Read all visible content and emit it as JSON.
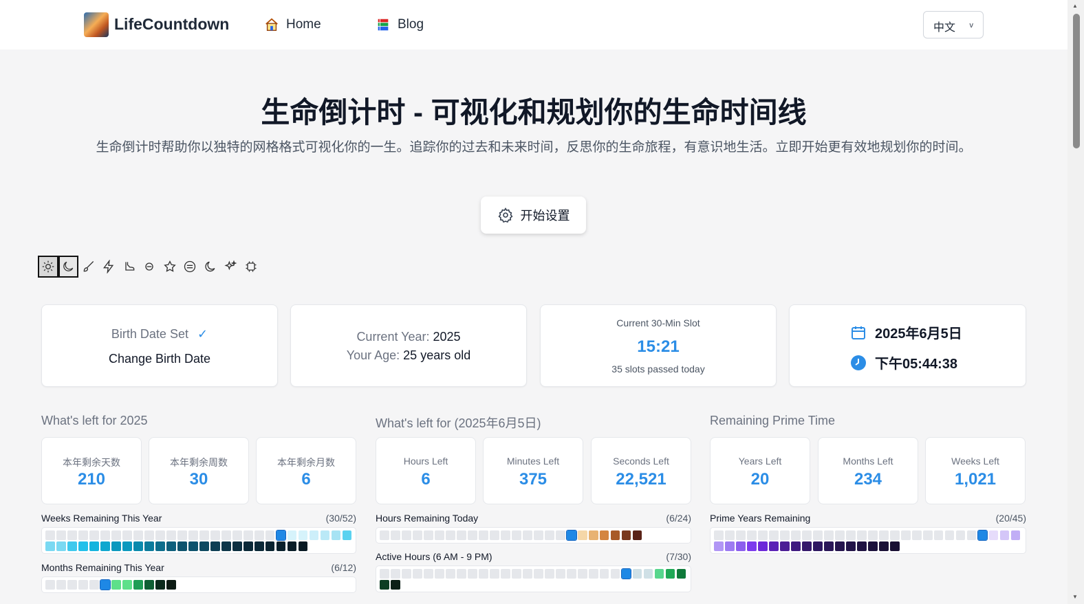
{
  "nav": {
    "brand": "LifeCountdown",
    "home": "Home",
    "blog": "Blog",
    "language": "中文",
    "language_chevron": "v"
  },
  "hero": {
    "title": "生命倒计时 - 可视化和规划你的生命时间线",
    "subtitle": "生命倒计时帮助你以独特的网格格式可视化你的一生。追踪你的过去和未来时间，反思你的生命旅程，有意识地生活。立即开始更有效地规划你的时间。",
    "start_button": "开始设置"
  },
  "themes": [
    "sun-icon",
    "moon-icon",
    "brush-icon",
    "lightning-icon",
    "boot-icon",
    "candy-icon",
    "star-icon",
    "circle-icon",
    "crescent-icon",
    "sparkles-icon",
    "chip-icon"
  ],
  "birth_card": {
    "status": "Birth Date Set",
    "check": "✓",
    "action": "Change Birth Date"
  },
  "year_card": {
    "year_label": "Current Year: ",
    "year_value": "2025",
    "age_label": "Your Age: ",
    "age_value": "25 years old"
  },
  "slot_card": {
    "label": "Current 30-Min Slot",
    "value": "15:21",
    "note": "35 slots passed today"
  },
  "datetime_card": {
    "date": "2025年6月5日",
    "time": "下午05:44:38"
  },
  "sections": {
    "year": {
      "title": "What's left for 2025",
      "stats": [
        {
          "label": "本年剩余天数",
          "value": "210"
        },
        {
          "label": "本年剩余周数",
          "value": "30"
        },
        {
          "label": "本年剩余月数",
          "value": "6"
        }
      ],
      "grids": [
        {
          "label": "Weeks Remaining This Year",
          "count": "(30/52)"
        },
        {
          "label": "Months Remaining This Year",
          "count": "(6/12)"
        }
      ]
    },
    "day": {
      "title": "What's left for (2025年6月5日)",
      "stats": [
        {
          "label": "Hours Left",
          "value": "6"
        },
        {
          "label": "Minutes Left",
          "value": "375"
        },
        {
          "label": "Seconds Left",
          "value": "22,521"
        }
      ],
      "grids": [
        {
          "label": "Hours Remaining Today",
          "count": "(6/24)"
        },
        {
          "label": "Active Hours (6 AM - 9 PM)",
          "count": "(7/30)"
        }
      ]
    },
    "prime": {
      "title": "Remaining Prime Time",
      "stats": [
        {
          "label": "Years Left",
          "value": "20"
        },
        {
          "label": "Months Left",
          "value": "234"
        },
        {
          "label": "Weeks Left",
          "value": "1,021"
        }
      ],
      "grids": [
        {
          "label": "Prime Years Remaining",
          "count": "(20/45)"
        }
      ]
    }
  },
  "grid_colors": {
    "weeks": [
      "#d6f3fb",
      "#cdeffa",
      "#bae9f7",
      "#a7e3f4",
      "#5bd2f0",
      "#7ad9f2",
      "#3ec9ed",
      "#22c0ea",
      "#14b4de",
      "#0fa7cf",
      "#0b99be",
      "#0a8aad",
      "#0b7b9c",
      "#0c6d8c",
      "#0d5f7c",
      "#0e536d",
      "#0e4960",
      "#0e3f54",
      "#0d3649",
      "#0c2f40",
      "#0b2938",
      "#0a2431",
      "#0a202c",
      "#091c27",
      "#081923"
    ],
    "months": [
      "#5ee08a",
      "#1f9d55",
      "#0f5f34",
      "#0b2a1c",
      "#0d1b14"
    ],
    "hours": [
      "#f5d7a8",
      "#e8b272",
      "#d48540",
      "#a85a27",
      "#7a3a1f",
      "#5a2318"
    ],
    "active": [
      "#cfe0e6",
      "#57d68d",
      "#1fa855",
      "#0f7a3a",
      "#0b3d22",
      "#0d1f17"
    ],
    "prime": [
      "#e6dcfb",
      "#d4c6f8",
      "#c1aef6",
      "#b196f5",
      "#9d7bf2",
      "#8c5fee",
      "#7c3aed",
      "#6d28d9",
      "#5b21b6",
      "#4c1d95",
      "#3f1a80",
      "#35186b",
      "#2e1761",
      "#2a1658",
      "#25144e",
      "#221348",
      "#1f1242",
      "#1c113c",
      "#1a1036",
      "#190f33"
    ]
  }
}
